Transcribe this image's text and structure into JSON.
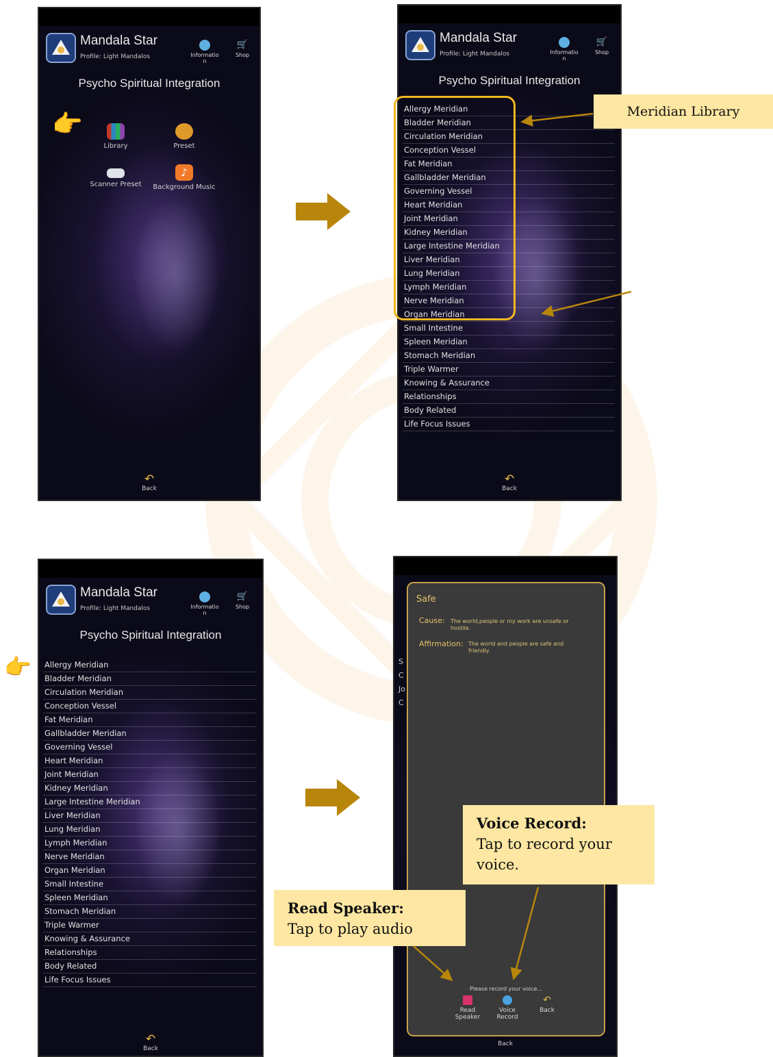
{
  "app": {
    "title": "Mandala Star",
    "profile": "Profile: Light Mandalos",
    "info_label": "Information",
    "shop_label": "Shop",
    "screen_title": "Psycho Spiritual Integration",
    "back_label": "Back"
  },
  "home_menu": [
    "Library",
    "Preset",
    "Scanner Preset",
    "Background Music"
  ],
  "meridians": [
    "Allergy Meridian",
    "Bladder Meridian",
    "Circulation Meridian",
    "Conception Vessel",
    "Fat Meridian",
    "Gallbladder Meridian",
    "Governing Vessel",
    "Heart Meridian",
    "Joint Meridian",
    "Kidney Meridian",
    "Large Intestine Meridian",
    "Liver Meridian",
    "Lung Meridian",
    "Lymph Meridian",
    "Nerve Meridian",
    "Organ Meridian",
    "Small Intestine",
    "Spleen Meridian",
    "Stomach Meridian",
    "Triple Warmer",
    "Knowing & Assurance",
    "Relationships",
    "Body Related",
    "Life Focus Issues"
  ],
  "callouts": {
    "meridian_library": "Meridian Library",
    "voice_record_title": "Voice Record",
    "voice_record_text": "Tap to record your voice.",
    "read_speaker_title": "Read Speaker",
    "read_speaker_text": "Tap to play audio"
  },
  "dialog": {
    "title": "Safe",
    "cause_label": "Cause:",
    "cause_text": "The world,people or my work are unsafe or hostile.",
    "affirmation_label": "Affirmation:",
    "affirmation_text": "The world and people are safe and friendly.",
    "prompt": "Please record your voice...",
    "read_speaker": "Read Speaker",
    "voice_record": "Voice Record",
    "back": "Back"
  },
  "behind_letters": [
    "S",
    "C",
    "Jo",
    "C"
  ],
  "colors": {
    "accent_gold": "#b8860b",
    "callout_bg": "#fde7a2",
    "highlight_border": "#f2b820",
    "dialog_border": "#c8a14a",
    "screen_bg": "#0b0a18"
  },
  "icons": {
    "pointer": "hand-pointing-right-icon",
    "back": "back-arrow-icon",
    "info": "globe-info-icon",
    "shop": "shopping-cart-icon"
  }
}
